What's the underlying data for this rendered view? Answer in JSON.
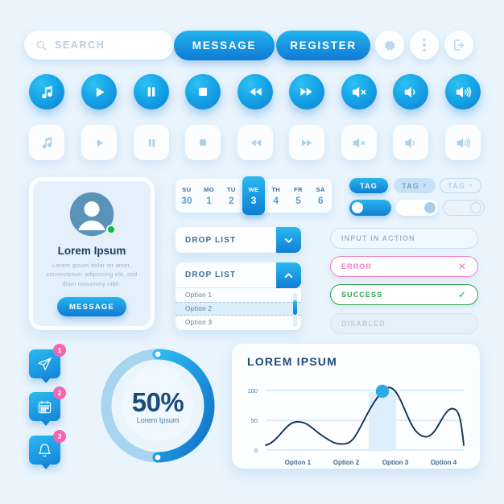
{
  "theme": {
    "bg": "#e9f4fd",
    "accent_light": "#2cb8ef",
    "accent_dark": "#0f7ed4",
    "error": "#f07fc0",
    "success": "#27a34a",
    "badge": "#f464b0",
    "status_online": "#17b939"
  },
  "toolbar": {
    "search_placeholder": "SEARCH",
    "message_label": "MESSAGE",
    "register_label": "REGISTER",
    "icons": [
      "gear-icon",
      "more-vertical-icon",
      "logout-icon"
    ]
  },
  "media_buttons": [
    {
      "name": "music",
      "icon": "music-note-icon"
    },
    {
      "name": "play",
      "icon": "play-icon"
    },
    {
      "name": "pause",
      "icon": "pause-icon"
    },
    {
      "name": "stop",
      "icon": "stop-icon"
    },
    {
      "name": "rewind",
      "icon": "rewind-icon"
    },
    {
      "name": "fast-forward",
      "icon": "fast-forward-icon"
    },
    {
      "name": "mute",
      "icon": "volume-mute-icon"
    },
    {
      "name": "volume-low",
      "icon": "volume-low-icon"
    },
    {
      "name": "volume-high",
      "icon": "volume-high-icon"
    }
  ],
  "profile_card": {
    "title": "Lorem Ipsum",
    "description": "Lorem ipsum dolor sit amet, consectetuer adipiscing elit, sed diam nonummy nibh.",
    "button_label": "MESSAGE",
    "status": "online"
  },
  "calendar": {
    "days": [
      {
        "dow": "SU",
        "num": "30",
        "active": false
      },
      {
        "dow": "MO",
        "num": "1",
        "active": false
      },
      {
        "dow": "TU",
        "num": "2",
        "active": false
      },
      {
        "dow": "WE",
        "num": "3",
        "active": true
      },
      {
        "dow": "TH",
        "num": "4",
        "active": false
      },
      {
        "dow": "FR",
        "num": "5",
        "active": false
      },
      {
        "dow": "SA",
        "num": "6",
        "active": false
      }
    ]
  },
  "tags": [
    {
      "label": "TAG",
      "closable": false,
      "state": "active"
    },
    {
      "label": "TAG",
      "closable": true,
      "state": "filled"
    },
    {
      "label": "TAG",
      "closable": true,
      "state": "outline"
    }
  ],
  "toggles": [
    {
      "state": "on"
    },
    {
      "state": "off"
    },
    {
      "state": "disabled"
    }
  ],
  "dropdown_collapsed": {
    "label": "DROP LIST",
    "chevron": "chevron-down-icon"
  },
  "dropdown_expanded": {
    "label": "DROP LIST",
    "chevron": "chevron-up-icon",
    "options": [
      "Option 1",
      "Option 2",
      "Option 3"
    ],
    "selected_index": 1
  },
  "inputs": [
    {
      "label": "INPUT IN ACTION",
      "state": "action",
      "sign": ""
    },
    {
      "label": "ERROR",
      "state": "error",
      "sign": "✕"
    },
    {
      "label": "SUCCESS",
      "state": "success",
      "sign": "✓"
    },
    {
      "label": "DISABLED",
      "state": "disabled",
      "sign": ""
    }
  ],
  "notifications": [
    {
      "icon": "send-icon",
      "count": "1"
    },
    {
      "icon": "calendar-icon",
      "count": "2"
    },
    {
      "icon": "bell-icon",
      "count": "3"
    }
  ],
  "donut": {
    "percent_label": "50%",
    "sub_label": "Lorem Ipsum",
    "value": 50
  },
  "chart_data": {
    "type": "line",
    "title": "LOREM IPSUM",
    "categories": [
      "Option 1",
      "Option 2",
      "Option 3",
      "Option 4"
    ],
    "x": [
      0,
      1,
      2,
      3
    ],
    "values": [
      47,
      17,
      100,
      70
    ],
    "xlabel": "",
    "ylabel": "",
    "ylim": [
      0,
      100
    ],
    "yticks": [
      "0",
      "50",
      "100"
    ],
    "grid": true,
    "legend": "none",
    "highlight_category": "Option 3",
    "marker_point": {
      "category": "Option 3",
      "value": 100
    }
  }
}
